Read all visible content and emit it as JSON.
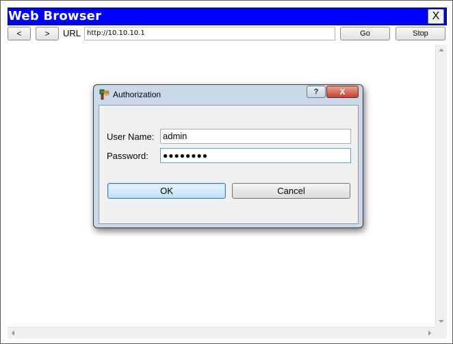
{
  "window": {
    "title": "Web Browser",
    "close_label": "X"
  },
  "toolbar": {
    "back_label": "<",
    "forward_label": ">",
    "url_label": "URL",
    "url_value": "http://10.10.10.1",
    "go_label": "Go",
    "stop_label": "Stop"
  },
  "dialog": {
    "title": "Authorization",
    "help_label": "?",
    "close_label": "X",
    "username_label": "User Name:",
    "username_value": "admin",
    "password_label": "Password:",
    "password_mask": "●●●●●●●●",
    "ok_label": "OK",
    "cancel_label": "Cancel"
  },
  "colors": {
    "titlebar": "#0000ff",
    "dialog_frame": "#c9d9ea"
  }
}
